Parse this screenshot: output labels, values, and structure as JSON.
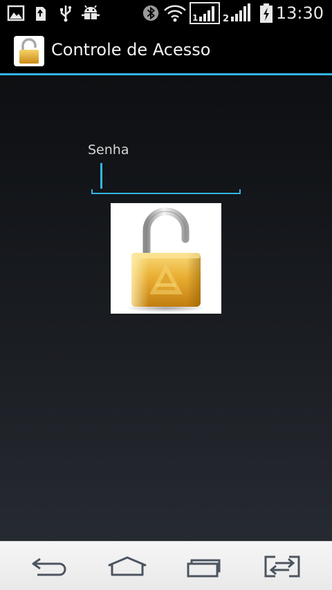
{
  "status_bar": {
    "time": "13:30",
    "icons": [
      "gallery-notification-icon",
      "usb-storage-icon",
      "usb-icon",
      "android-debug-icon",
      "bluetooth-icon",
      "wifi-icon",
      "sim1-signal-icon",
      "sim2-signal-icon",
      "battery-charging-icon"
    ],
    "sim1_label": "1",
    "sim2_label": "2"
  },
  "action_bar": {
    "title": "Controle de Acesso",
    "icon": "padlock-icon"
  },
  "form": {
    "password_label": "Senha",
    "password_value": ""
  },
  "lock_button": {
    "icon": "open-padlock-icon",
    "state": "unlocked"
  },
  "nav_bar": {
    "buttons": [
      "back-icon",
      "home-icon",
      "recent-apps-icon",
      "dual-window-icon"
    ]
  },
  "colors": {
    "accent": "#33b5e5",
    "status_bar_bg": "#000000",
    "nav_bar_bg": "#f1f1f1",
    "padlock_gold": "#e0a52a"
  }
}
